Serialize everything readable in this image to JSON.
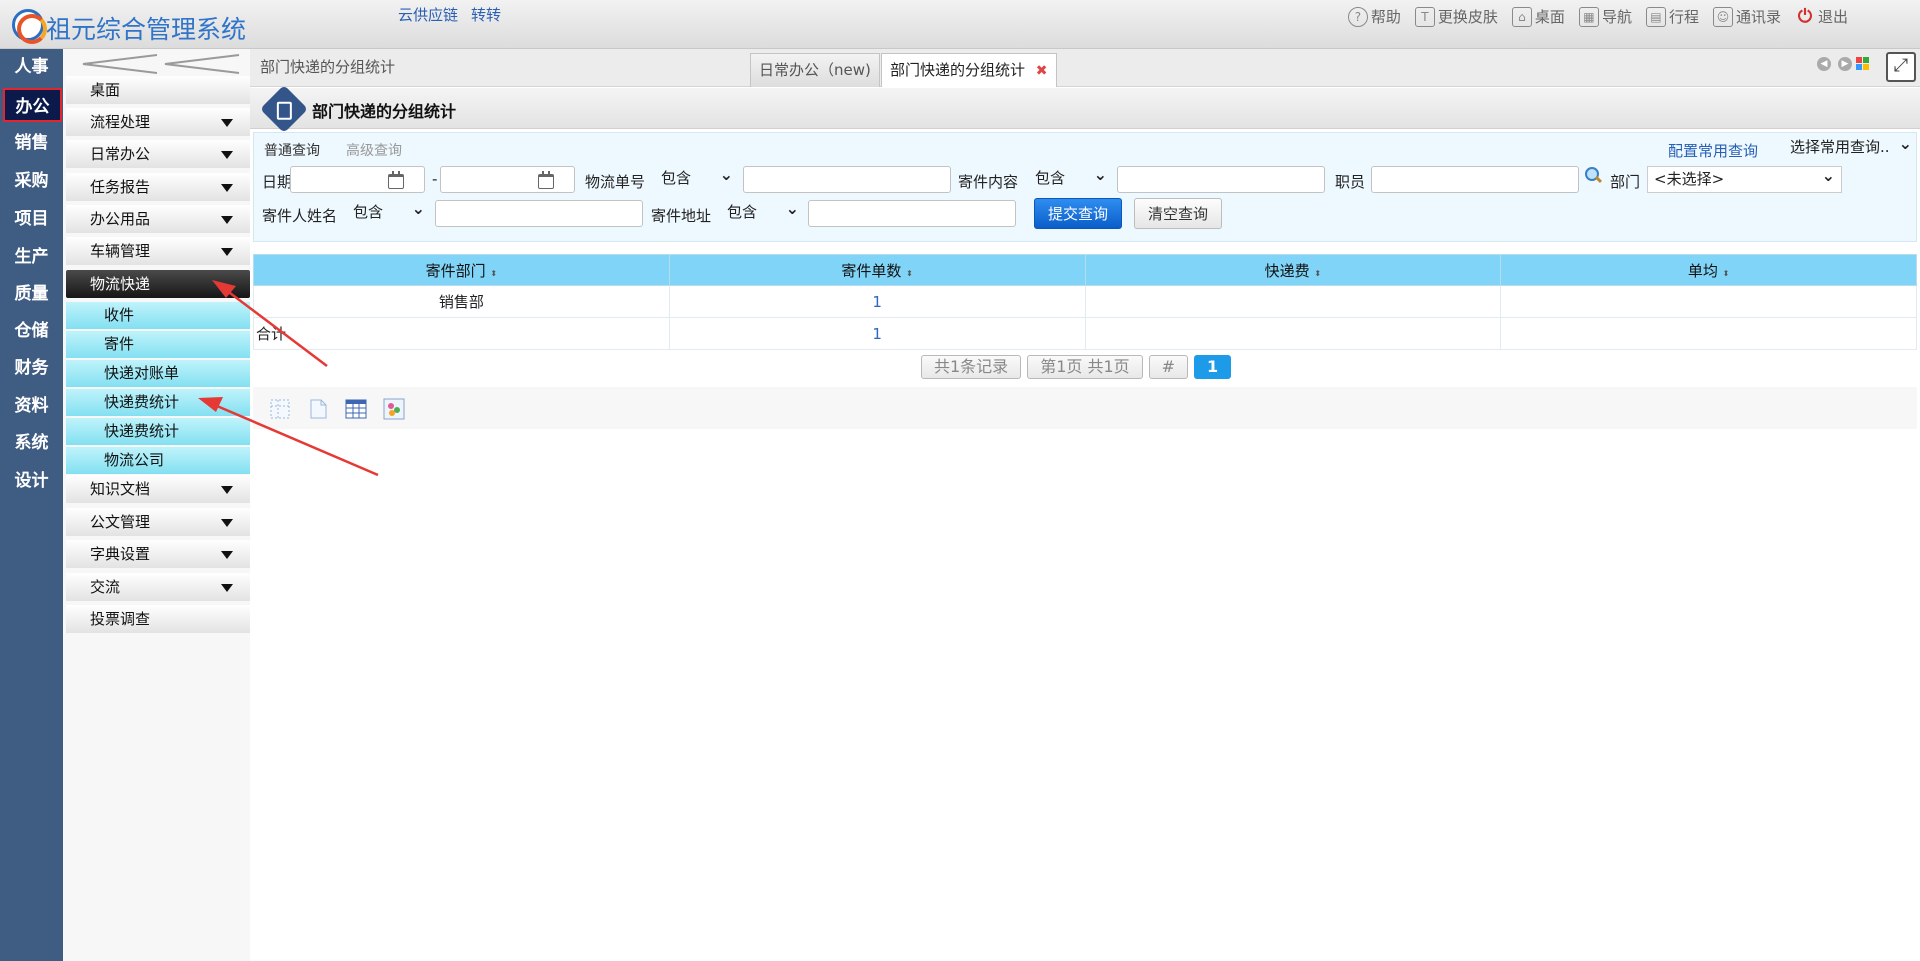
{
  "app": {
    "title": "祖元综合管理系统"
  },
  "top_links": [
    "云供应链",
    "转转"
  ],
  "top_menu": [
    {
      "label": "帮助",
      "icon": "help-icon"
    },
    {
      "label": "更换皮肤",
      "icon": "shirt-icon"
    },
    {
      "label": "桌面",
      "icon": "home-icon"
    },
    {
      "label": "导航",
      "icon": "grid-nav-icon"
    },
    {
      "label": "行程",
      "icon": "calendar-icon"
    },
    {
      "label": "通讯录",
      "icon": "contact-icon"
    },
    {
      "label": "退出",
      "icon": "power-icon"
    }
  ],
  "categories": [
    "人事",
    "办公",
    "销售",
    "采购",
    "项目",
    "生产",
    "质量",
    "仓储",
    "财务",
    "资料",
    "系统",
    "设计"
  ],
  "active_category": "办公",
  "menu": {
    "items": [
      {
        "label": "桌面",
        "has_arrow": false
      },
      {
        "label": "流程处理",
        "has_arrow": true
      },
      {
        "label": "日常办公",
        "has_arrow": true
      },
      {
        "label": "任务报告",
        "has_arrow": true
      },
      {
        "label": "办公用品",
        "has_arrow": true
      },
      {
        "label": "车辆管理",
        "has_arrow": true
      },
      {
        "label": "物流快递",
        "has_arrow": false,
        "open": true
      }
    ],
    "sub_items": [
      "收件",
      "寄件",
      "快递对账单",
      "快递费统计",
      "快递费统计",
      "物流公司"
    ],
    "items_after": [
      {
        "label": "知识文档",
        "has_arrow": true
      },
      {
        "label": "公文管理",
        "has_arrow": true
      },
      {
        "label": "字典设置",
        "has_arrow": true
      },
      {
        "label": "交流",
        "has_arrow": true
      },
      {
        "label": "投票调查",
        "has_arrow": false
      }
    ]
  },
  "breadcrumb": "部门快递的分组统计",
  "tabs": [
    {
      "label": "日常办公（new)",
      "active": false
    },
    {
      "label": "部门快递的分组统计",
      "active": true,
      "closable": true,
      "close_glyph": "✖"
    }
  ],
  "expand_glyph": "⤢",
  "page_title": "部门快递的分组统计",
  "query": {
    "tab_normal": "普通查询",
    "tab_advanced": "高级查询",
    "config_link": "配置常用查询",
    "saved_query": "选择常用查询..",
    "date_label": "日期",
    "date_sep": "-",
    "tracking_label": "物流单号",
    "tracking_op": "包含",
    "content_label": "寄件内容",
    "content_op": "包含",
    "staff_label": "职员",
    "dept_label": "部门",
    "dept_value": "<未选择>",
    "sender_label": "寄件人姓名",
    "sender_op": "包含",
    "address_label": "寄件地址",
    "address_op": "包含",
    "submit": "提交查询",
    "clear": "清空查询"
  },
  "table": {
    "headers": [
      "寄件部门",
      "寄件单数",
      "快递费",
      "单均"
    ],
    "sort_glyph": "⬍",
    "rows": [
      [
        "销售部",
        "1",
        "",
        ""
      ]
    ],
    "total": [
      "合计",
      "1",
      "",
      ""
    ]
  },
  "pager": {
    "records": "共1条记录",
    "pages": "第1页 共1页",
    "hash": "#",
    "current": "1"
  },
  "colors": {
    "left_bar": "#3f5c83",
    "active_cat_border": "#e2262c",
    "header_row": "#7fd4f7",
    "sub_item": "#83e0f1",
    "arrow": "#e53935"
  }
}
